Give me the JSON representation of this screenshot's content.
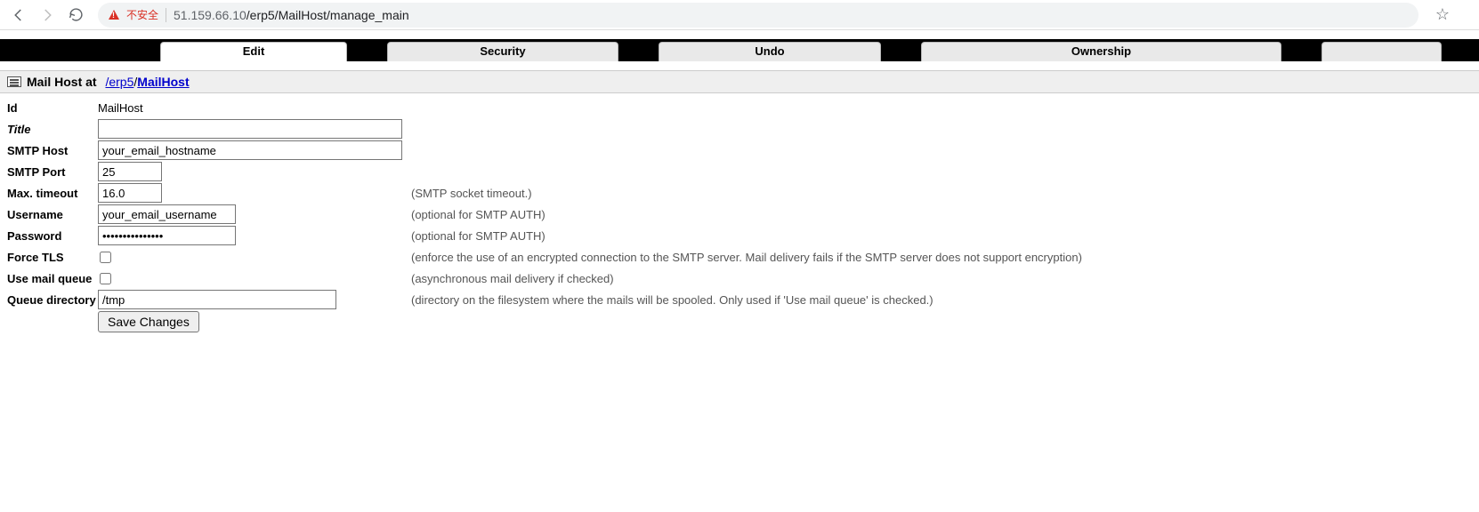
{
  "browser": {
    "not_secure_label": "不安全",
    "url_host": "51.159.66.10",
    "url_path": "/erp5/MailHost/manage_main"
  },
  "tabs": {
    "edit": "Edit",
    "security": "Security",
    "undo": "Undo",
    "ownership": "Ownership"
  },
  "breadcrumb": {
    "object_label": "Mail Host at",
    "seg1": "/erp5",
    "seg2": "MailHost"
  },
  "form": {
    "id_label": "Id",
    "id_value": "MailHost",
    "title_label": "Title",
    "title_value": "",
    "smtp_host_label": "SMTP Host",
    "smtp_host_value": "your_email_hostname",
    "smtp_port_label": "SMTP Port",
    "smtp_port_value": "25",
    "max_timeout_label": "Max. timeout",
    "max_timeout_value": "16.0",
    "max_timeout_hint": "(SMTP socket timeout.)",
    "username_label": "Username",
    "username_value": "your_email_username",
    "username_hint": "(optional for SMTP AUTH)",
    "password_label": "Password",
    "password_value": "•••••••••••••••",
    "password_hint": "(optional for SMTP AUTH)",
    "force_tls_label": "Force TLS",
    "force_tls_checked": false,
    "force_tls_hint": "(enforce the use of an encrypted connection to the SMTP server. Mail delivery fails if the SMTP server does not support encryption)",
    "use_queue_label": "Use mail queue",
    "use_queue_checked": false,
    "use_queue_hint": "(asynchronous mail delivery if checked)",
    "queue_dir_label": "Queue directory",
    "queue_dir_value": "/tmp",
    "queue_dir_hint": "(directory on the filesystem where the mails will be spooled. Only used if 'Use mail queue' is checked.)",
    "save_label": "Save Changes"
  }
}
